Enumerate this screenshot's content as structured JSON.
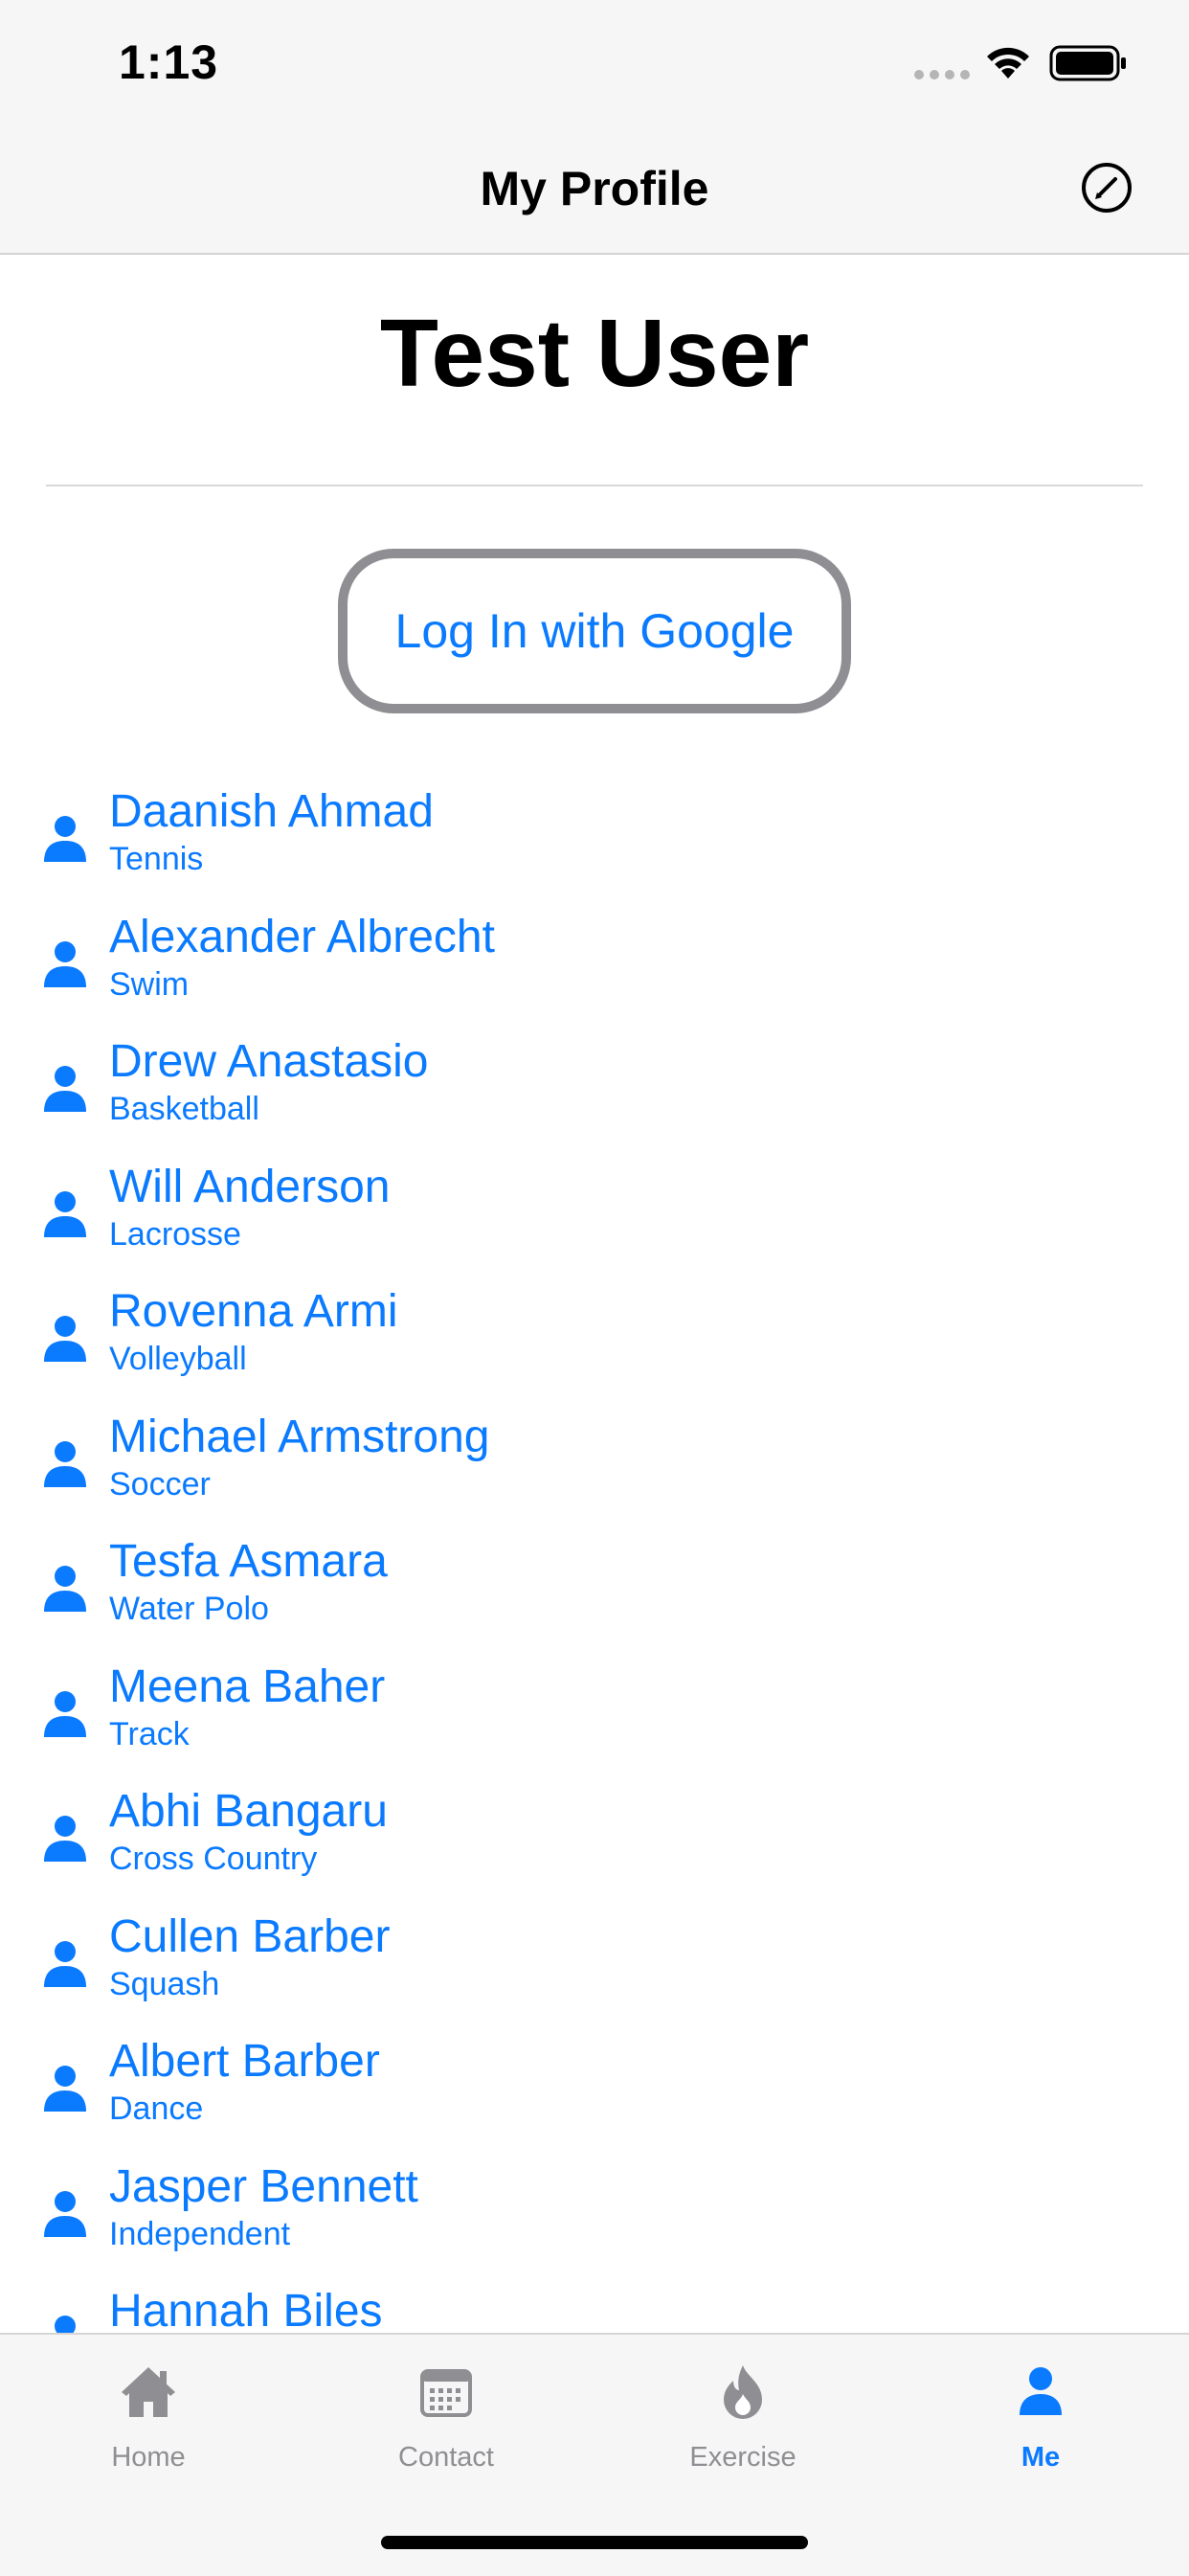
{
  "status_bar": {
    "time": "1:13"
  },
  "nav": {
    "title": "My Profile",
    "compose_icon": "compose-icon"
  },
  "profile": {
    "name": "Test User",
    "login_button": "Log In with Google"
  },
  "contacts": [
    {
      "name": "Daanish Ahmad",
      "sport": "Tennis"
    },
    {
      "name": "Alexander Albrecht",
      "sport": "Swim"
    },
    {
      "name": "Drew Anastasio",
      "sport": "Basketball"
    },
    {
      "name": "Will Anderson",
      "sport": "Lacrosse"
    },
    {
      "name": "Rovenna Armi",
      "sport": "Volleyball"
    },
    {
      "name": "Michael Armstrong",
      "sport": "Soccer"
    },
    {
      "name": "Tesfa Asmara",
      "sport": "Water Polo"
    },
    {
      "name": "Meena Baher",
      "sport": "Track"
    },
    {
      "name": "Abhi Bangaru",
      "sport": "Cross Country"
    },
    {
      "name": "Cullen Barber",
      "sport": "Squash"
    },
    {
      "name": "Albert Barber",
      "sport": "Dance"
    },
    {
      "name": "Jasper Bennett",
      "sport": "Independent"
    },
    {
      "name": "Hannah Biles",
      "sport": ""
    }
  ],
  "tabs": [
    {
      "label": "Home",
      "icon": "home-icon",
      "active": false
    },
    {
      "label": "Contact",
      "icon": "calendar-icon",
      "active": false
    },
    {
      "label": "Exercise",
      "icon": "flame-icon",
      "active": false
    },
    {
      "label": "Me",
      "icon": "person-icon",
      "active": true
    }
  ],
  "colors": {
    "accent": "#0a7aff",
    "inactive": "#8e8e93",
    "bar_background": "#f6f6f6"
  }
}
